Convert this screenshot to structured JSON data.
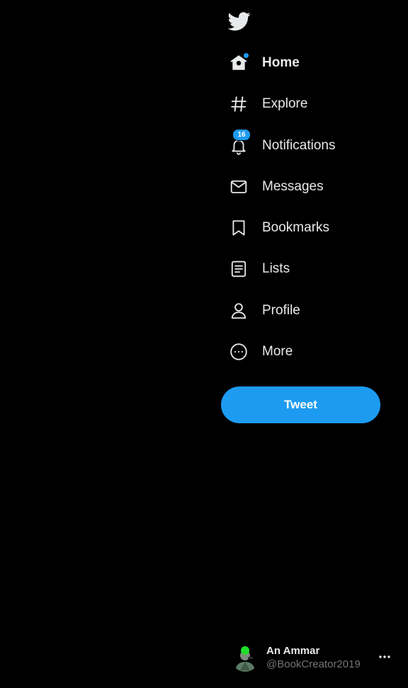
{
  "brand": {
    "logo_icon": "twitter-bird-icon",
    "accent_color": "#1d9bf0"
  },
  "nav": {
    "items": [
      {
        "key": "home",
        "label": "Home",
        "icon": "home-icon",
        "active": true
      },
      {
        "key": "explore",
        "label": "Explore",
        "icon": "hashtag-icon"
      },
      {
        "key": "notifications",
        "label": "Notifications",
        "icon": "bell-icon",
        "badge": "16"
      },
      {
        "key": "messages",
        "label": "Messages",
        "icon": "envelope-icon"
      },
      {
        "key": "bookmarks",
        "label": "Bookmarks",
        "icon": "bookmark-icon"
      },
      {
        "key": "lists",
        "label": "Lists",
        "icon": "list-icon"
      },
      {
        "key": "profile",
        "label": "Profile",
        "icon": "person-icon"
      },
      {
        "key": "more",
        "label": "More",
        "icon": "more-circle-icon"
      }
    ]
  },
  "tweet_button": {
    "label": "Tweet"
  },
  "account": {
    "name": "An Ammar",
    "handle": "@BookCreator2019",
    "menu_icon": "more-horizontal-icon"
  }
}
